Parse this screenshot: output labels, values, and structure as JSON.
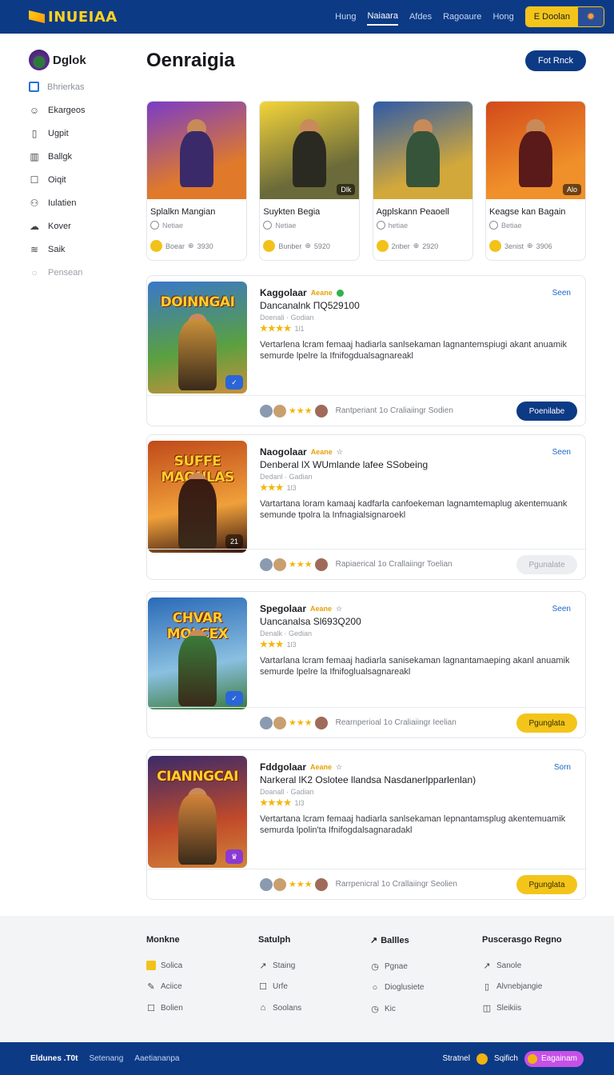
{
  "app": {
    "logo_text": "INUEIAA"
  },
  "topnav": {
    "items": [
      "Hung",
      "Naiaara",
      "Afdes",
      "Ragoaure",
      "Hong"
    ],
    "active_index": 1,
    "signin_label": "E Doolan",
    "gear_icon": "gear-icon"
  },
  "sidebar": {
    "title": "Dglok",
    "items": [
      {
        "label": "Bhrierkas",
        "icon": "square-icon",
        "state": "selected"
      },
      {
        "label": "Ekargeos",
        "icon": "user-icon",
        "state": "normal"
      },
      {
        "label": "Ugpit",
        "icon": "document-icon",
        "state": "normal"
      },
      {
        "label": "Ballgk",
        "icon": "building-icon",
        "state": "normal"
      },
      {
        "label": "Oiqit",
        "icon": "square-icon",
        "state": "normal"
      },
      {
        "label": "Iulatien",
        "icon": "people-icon",
        "state": "normal"
      },
      {
        "label": "Kover",
        "icon": "cloud-icon",
        "state": "normal"
      },
      {
        "label": "Saik",
        "icon": "wifi-icon",
        "state": "normal"
      },
      {
        "label": "Pensean",
        "icon": "circle-icon",
        "state": "muted"
      }
    ]
  },
  "main": {
    "title": "Oenraigia",
    "feedback_label": "Fot Rnck"
  },
  "featured": [
    {
      "title": "Splalkn Mangian",
      "sub": "Netiae",
      "coin_label": "Boear",
      "count": "3930",
      "tag": "",
      "colors": [
        "#7a3cc8",
        "#e07a2a",
        "#3a2a6a"
      ]
    },
    {
      "title": "Suykten Begia",
      "sub": "Netiae",
      "coin_label": "Bunber",
      "count": "5920",
      "tag": "Dlk",
      "colors": [
        "#f4d43a",
        "#6a6a3a",
        "#2a2a22"
      ]
    },
    {
      "title": "Agplskann Peaoell",
      "sub": "hetiae",
      "coin_label": "2nber",
      "count": "2920",
      "tag": "",
      "colors": [
        "#2e5aa8",
        "#d2a83a",
        "#36543a"
      ]
    },
    {
      "title": "Keagse kan Bagain",
      "sub": "Betiae",
      "coin_label": "3enist",
      "count": "3906",
      "tag": "Alo",
      "colors": [
        "#d24a1a",
        "#f0902a",
        "#5a1a1a"
      ]
    }
  ],
  "listings": [
    {
      "name": "Kaggolaar",
      "badge": "Aeane",
      "mark": "green-dot",
      "price": "Dancanalnk  ΠQ529100",
      "meta": "Doenali · Godian",
      "stars": "★★★★",
      "rating": "1l1",
      "desc": "Vertarlena lcram femaaj hadiarla sanlsekaman lagnantemspiugi akant anuamik semurde lpelre la Ifnifogdualsagnareakl",
      "save": "Seen",
      "footer_text": "Rantperiant   1o Craliaiingr Sodien",
      "button": "Poenilabe",
      "button_style": "navy",
      "banner": "DOINNGAI",
      "colors": [
        "#3a78c8",
        "#5aa040",
        "#c8903a"
      ]
    },
    {
      "name": "Naogolaar",
      "badge": "Aeane",
      "mark": "star-outline",
      "price": "Denberal  lX  WUmlande  lafee SSobeing",
      "meta": "Dedanl · Gadian",
      "stars": "★★★",
      "rating": "1l3",
      "desc": "Vartartana loram kamaaj kadfarla canfoekeman lagnamtemaplug akentemuank semunde tpolra la Infnagialsignaroekl",
      "save": "Seen",
      "footer_text": "Rapiaerical   1o Crallaiingr Toelian",
      "button": "Pgunalate",
      "button_style": "ghost",
      "banner": "SUFFE MAONLAS",
      "colors": [
        "#c04a1a",
        "#f0a03a",
        "#3a1a12"
      ]
    },
    {
      "name": "Spegolaar",
      "badge": "Aeane",
      "mark": "star-outline",
      "price": "Uancanalsa  Sl693Q200",
      "meta": "Denalk · Gedian",
      "stars": "★★★",
      "rating": "1l3",
      "desc": "Vartarlana lcram femaaj hadiarla sanisekaman lagnantamaeping akanl anuamik semurde lpelre la Ifnifoglualsagnareakl",
      "save": "Seen",
      "footer_text": "Rearnperioal   1o Craliaiingr Ieelian",
      "button": "Pgunglata",
      "button_style": "yellow",
      "banner": "CHVAR MOLCEX",
      "colors": [
        "#2a6ab8",
        "#8ac0e0",
        "#3a7a3a"
      ]
    },
    {
      "name": "Fddgolaar",
      "badge": "Aeane",
      "mark": "star-outline",
      "price": "Narkeral  lK2  Oslotee  llandsa  Nasdanerlpparlenlan)",
      "meta": "Doanall · Gadian",
      "stars": "★★★★",
      "rating": "1l3",
      "desc": "Vertartana lcram femaaj hadiarla sanlsekaman lepnantamsplug akentemuamik semurda lpolin'ta Ifnifogdalsagnaradakl",
      "save": "Sorn",
      "footer_text": "Rarrpenicral   1o Crallaiingr Seolien",
      "button": "Pgunglata",
      "button_style": "yellow",
      "banner": "CIANNGCAI",
      "colors": [
        "#3a2a6a",
        "#c04a2a",
        "#d2843a"
      ]
    }
  ],
  "footer": {
    "columns": [
      {
        "title": "Monkne",
        "title_icon": "",
        "links": [
          {
            "label": "Solica",
            "icon": "yellow-square-icon"
          },
          {
            "label": "Aciice",
            "icon": "pencil-icon"
          },
          {
            "label": "Bolien",
            "icon": "square-icon"
          }
        ]
      },
      {
        "title": "Satulph",
        "title_icon": "",
        "links": [
          {
            "label": "Staing",
            "icon": "link-icon"
          },
          {
            "label": "Urfe",
            "icon": "square-icon"
          },
          {
            "label": "Soolans",
            "icon": "folder-icon"
          }
        ]
      },
      {
        "title": "Ballles",
        "title_icon": "link-icon",
        "links": [
          {
            "label": "Pgnae",
            "icon": "clock-icon"
          },
          {
            "label": "Dioglusiete",
            "icon": "circle-icon"
          },
          {
            "label": "Kic",
            "icon": "clock-icon"
          }
        ]
      },
      {
        "title": "Puscerasgo Regno",
        "title_icon": "",
        "links": [
          {
            "label": "Sanole",
            "icon": "link-icon"
          },
          {
            "label": "Alvnebjangie",
            "icon": "document-icon"
          },
          {
            "label": "Sleikiis",
            "icon": "camera-icon"
          }
        ]
      }
    ]
  },
  "bottombar": {
    "links": [
      "Eldunes .T0t",
      "Setenang",
      "Aaetiananpa"
    ],
    "right_label_1": "Stratnel",
    "right_label_2": "Sqifich",
    "explore_label": "Eagainam"
  },
  "colors": {
    "brand_navy": "#0d3a85",
    "accent_yellow": "#f3c51a",
    "link_blue": "#1d67c8"
  }
}
